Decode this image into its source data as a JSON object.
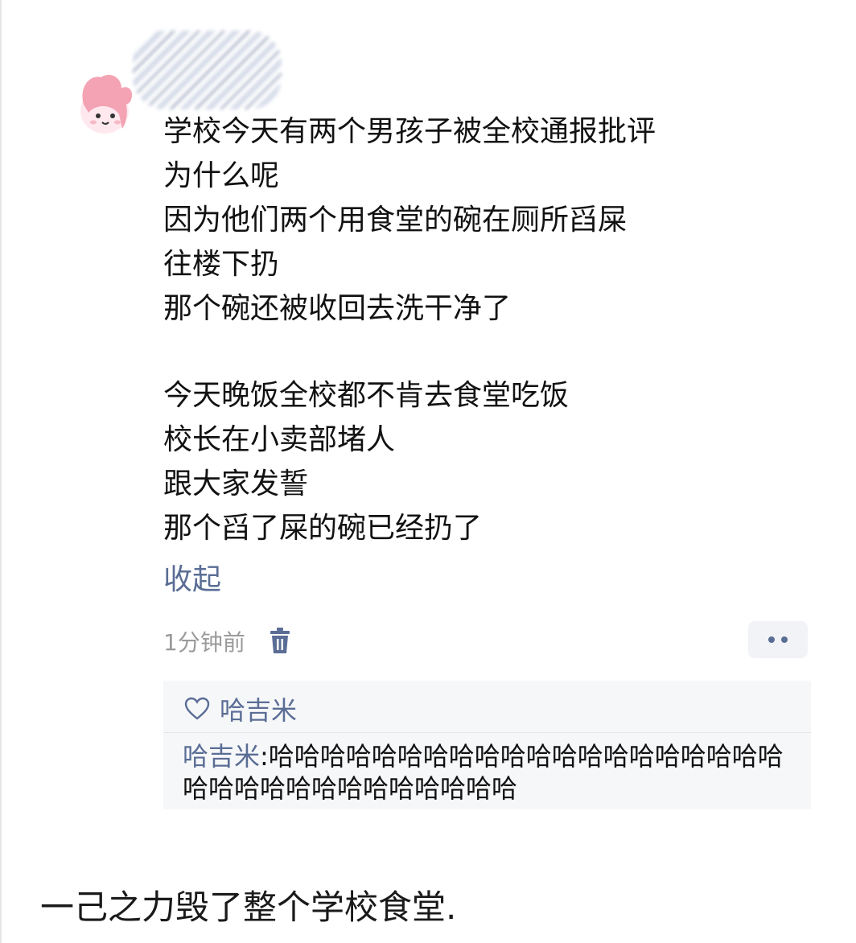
{
  "post": {
    "lines": [
      "学校今天有两个男孩子被全校通报批评",
      "为什么呢",
      "因为他们两个用食堂的碗在厕所舀屎",
      "往楼下扔",
      "那个碗还被收回去洗干净了",
      "",
      "今天晚饭全校都不肯去食堂吃饭",
      "校长在小卖部堵人",
      "跟大家发誓",
      "那个舀了屎的碗已经扔了"
    ],
    "collapse_label": "收起",
    "timestamp": "1分钟前"
  },
  "likes": {
    "names": "哈吉米"
  },
  "comment": {
    "author": "哈吉米",
    "separator": ":",
    "text": "哈哈哈哈哈哈哈哈哈哈哈哈哈哈哈哈哈哈哈哈哈哈哈哈哈哈哈哈哈哈哈哈哈"
  },
  "caption": "一己之力毁了整个学校食堂.",
  "colors": {
    "link": "#5a6d95",
    "text": "#121212",
    "meta": "#9a9a9a",
    "panel": "#f6f7f9"
  },
  "icons": {
    "avatar": "pink-cartoon-avatar",
    "delete": "trash-icon",
    "more": "more-dots-icon",
    "like": "heart-outline-icon"
  }
}
